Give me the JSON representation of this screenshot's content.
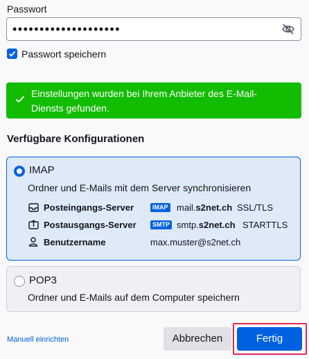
{
  "password": {
    "label": "Passwort",
    "value_masked": "••••••••••••••••••••",
    "toggle_icon": "eye-slash-icon"
  },
  "remember": {
    "label": "Passwort speichern",
    "checked": true
  },
  "success": {
    "message": "Einstellungen wurden bei Ihrem Anbieter des E-Mail-Diensts gefunden.",
    "color": "#12bc00"
  },
  "configs": {
    "title": "Verfügbare Konfigurationen",
    "imap": {
      "name": "IMAP",
      "selected": true,
      "description": "Ordner und E-Mails mit dem Server synchronisieren",
      "incoming_label": "Posteingangs-Server",
      "incoming_badge": "IMAP",
      "incoming_host_prefix": "mail.",
      "incoming_host_domain": "s2net.ch",
      "incoming_security": "SSL/TLS",
      "outgoing_label": "Postausgangs-Server",
      "outgoing_badge": "SMTP",
      "outgoing_host_prefix": "smtp.",
      "outgoing_host_domain": "s2net.ch",
      "outgoing_security": "STARTTLS",
      "username_label": "Benutzername",
      "username_value": "max.muster@s2net.ch"
    },
    "pop3": {
      "name": "POP3",
      "selected": false,
      "description": "Ordner und E-Mails auf dem Computer speichern"
    }
  },
  "footer": {
    "manual_link": "Manuell einrichten",
    "cancel_label": "Abbrechen",
    "done_label": "Fertig"
  },
  "colors": {
    "accent": "#0061e0",
    "highlight": "#e22850"
  }
}
